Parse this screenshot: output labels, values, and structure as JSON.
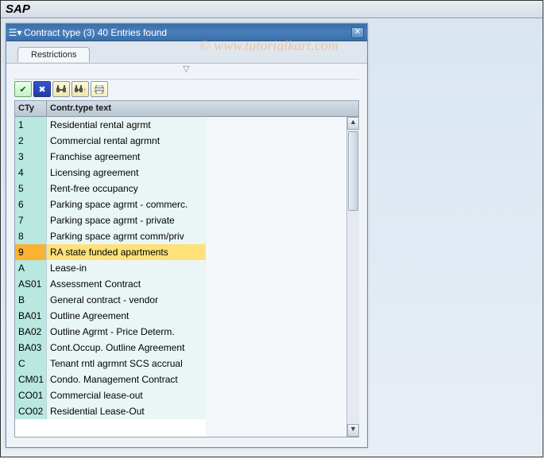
{
  "app_title": "SAP",
  "watermark": "© www.tutorialkart.com",
  "dialog": {
    "title": "Contract type (3)   40 Entries found",
    "tab_label": "Restrictions",
    "restriction_hint": "▽"
  },
  "toolbar": {
    "confirm": "✔",
    "cancel": "✖",
    "find": "🔍",
    "find_next": "🔎",
    "print": "🖶"
  },
  "table": {
    "col1": "CTy",
    "col2": "Contr.type text",
    "selected_index": 8,
    "rows": [
      {
        "cty": "1",
        "text": "Residential rental agrmt"
      },
      {
        "cty": "2",
        "text": "Commercial rental agrmnt"
      },
      {
        "cty": "3",
        "text": "Franchise agreement"
      },
      {
        "cty": "4",
        "text": "Licensing agreement"
      },
      {
        "cty": "5",
        "text": "Rent-free occupancy"
      },
      {
        "cty": "6",
        "text": "Parking space agrmt - commerc."
      },
      {
        "cty": "7",
        "text": "Parking space agrmt - private"
      },
      {
        "cty": "8",
        "text": "Parking space agrmt comm/priv"
      },
      {
        "cty": "9",
        "text": "RA state funded apartments"
      },
      {
        "cty": "A",
        "text": "Lease-in"
      },
      {
        "cty": "AS01",
        "text": "Assessment Contract"
      },
      {
        "cty": "B",
        "text": "General contract - vendor"
      },
      {
        "cty": "BA01",
        "text": "Outline Agreement"
      },
      {
        "cty": "BA02",
        "text": "Outline Agrmt - Price Determ."
      },
      {
        "cty": "BA03",
        "text": "Cont.Occup. Outline Agreement"
      },
      {
        "cty": "C",
        "text": "Tenant rntl agrmnt SCS accrual"
      },
      {
        "cty": "CM01",
        "text": "Condo. Management Contract"
      },
      {
        "cty": "CO01",
        "text": "Commercial lease-out"
      },
      {
        "cty": "CO02",
        "text": "Residential Lease-Out"
      }
    ]
  }
}
